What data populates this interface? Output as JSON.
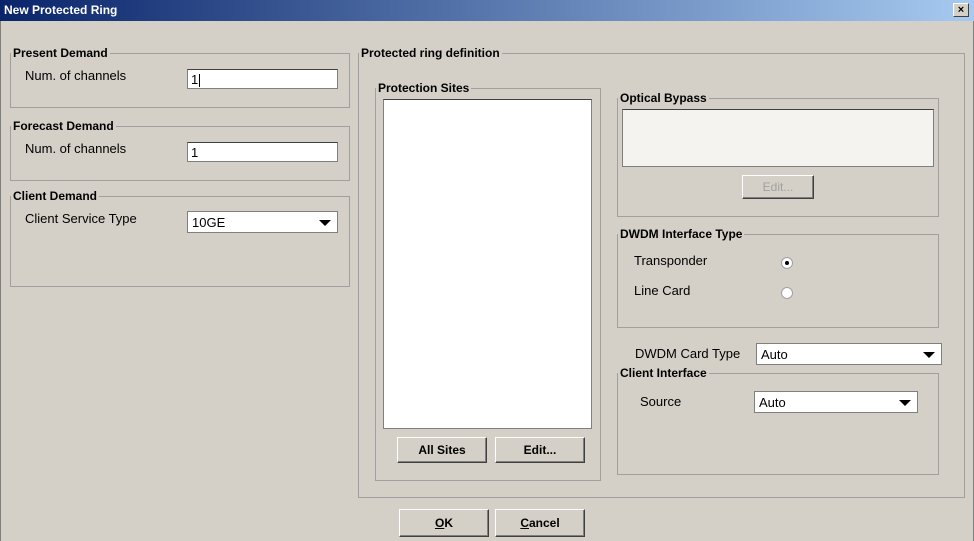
{
  "window": {
    "title": "New Protected Ring",
    "close_glyph": "×"
  },
  "present_demand": {
    "legend": "Present Demand",
    "label": "Num. of channels",
    "value": "1"
  },
  "forecast_demand": {
    "legend": "Forecast Demand",
    "label": "Num. of channels",
    "value": "1"
  },
  "client_demand": {
    "legend": "Client Demand",
    "label": "Client Service Type",
    "value": "10GE"
  },
  "ring_definition": {
    "legend": "Protected ring definition",
    "protection_sites": {
      "legend": "Protection Sites",
      "items": [],
      "all_sites_label": "All Sites",
      "edit_label": "Edit..."
    },
    "optical_bypass": {
      "legend": "Optical Bypass",
      "items": [],
      "edit_label": "Edit..."
    },
    "dwdm_interface": {
      "legend": "DWDM Interface Type",
      "options": [
        {
          "label": "Transponder",
          "selected": true
        },
        {
          "label": "Line Card",
          "selected": false
        }
      ]
    },
    "dwdm_card_type": {
      "label": "DWDM Card Type",
      "value": "Auto"
    },
    "client_interface": {
      "legend": "Client Interface",
      "label": "Source",
      "value": "Auto"
    }
  },
  "footer": {
    "ok_mnemonic": "O",
    "ok_rest": "K",
    "cancel_mnemonic": "C",
    "cancel_rest": "ancel"
  }
}
